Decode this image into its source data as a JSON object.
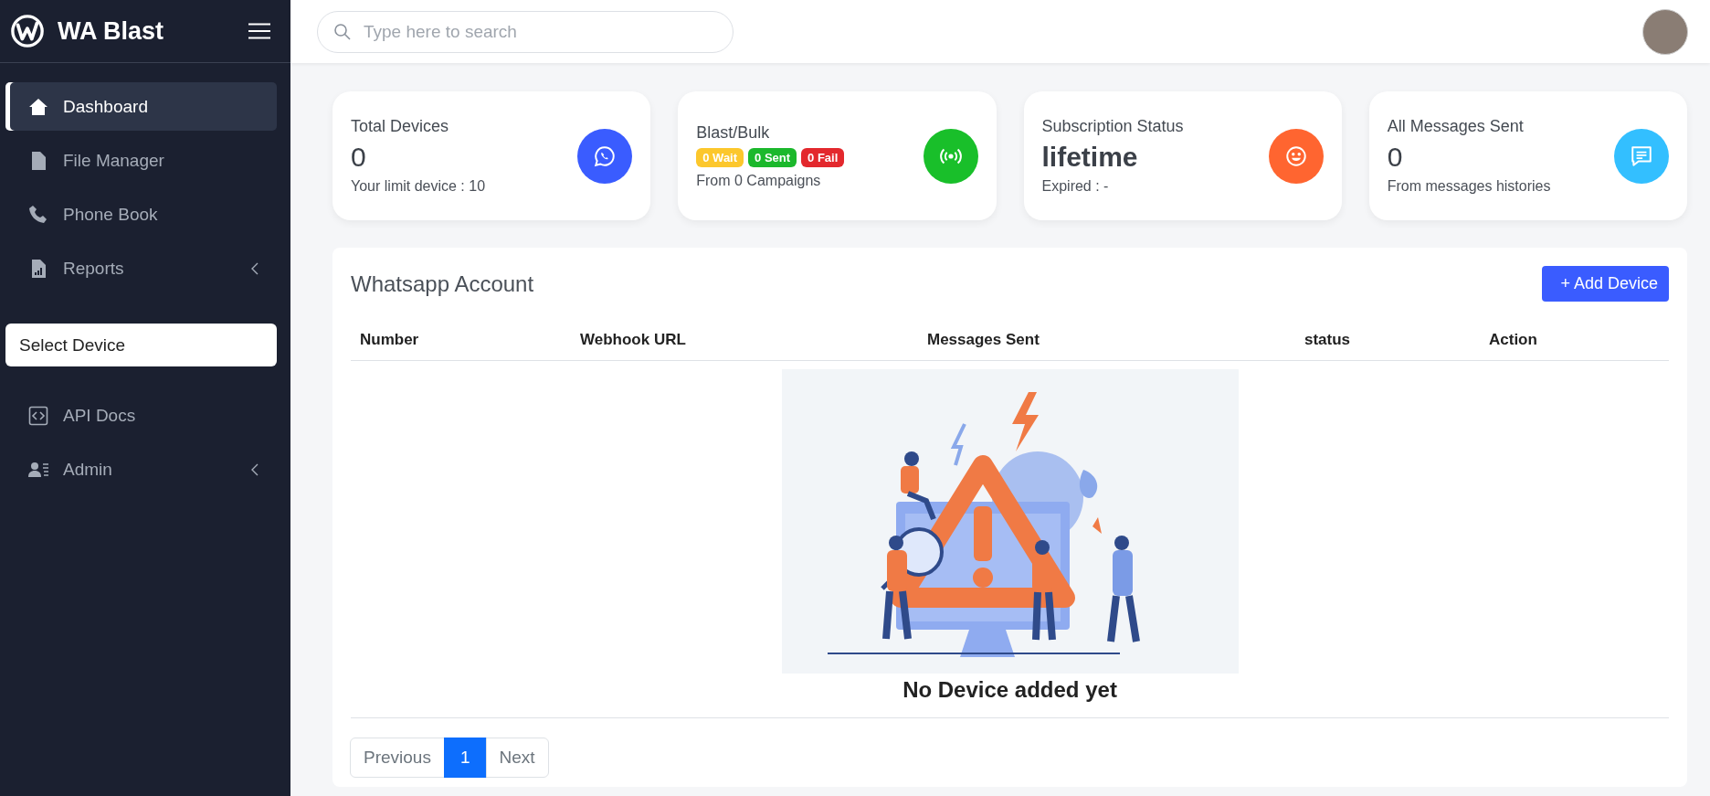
{
  "sidebar": {
    "brand": "WA Blast",
    "items": [
      {
        "label": "Dashboard",
        "selected": true,
        "submenu": false
      },
      {
        "label": "File Manager",
        "selected": false,
        "submenu": false
      },
      {
        "label": "Phone Book",
        "selected": false,
        "submenu": false
      },
      {
        "label": "Reports",
        "selected": false,
        "submenu": true
      }
    ],
    "device_select": {
      "value": "Select Device"
    },
    "items_after": [
      {
        "label": "API Docs",
        "selected": false,
        "submenu": false
      },
      {
        "label": "Admin",
        "selected": false,
        "submenu": true
      }
    ]
  },
  "topbar": {
    "search": {
      "placeholder": "Type here to search"
    }
  },
  "cards": [
    {
      "title": "Total Devices",
      "value": "0",
      "note": "Your limit device : 10",
      "color": "#3a5cff"
    },
    {
      "title": "Blast/Bulk",
      "badges": [
        {
          "label": "0 Wait",
          "color": "#fcc72c"
        },
        {
          "label": "0 Sent",
          "color": "#1bb82c"
        },
        {
          "label": "0 Fail",
          "color": "#e3282d"
        }
      ],
      "note": "From 0 Campaigns",
      "color": "#19bf2a"
    },
    {
      "title": "Subscription Status",
      "value": "lifetime",
      "note": "Expired : -",
      "color": "#ff6530"
    },
    {
      "title": "All Messages Sent",
      "value": "0",
      "note": "From messages histories",
      "color": "#33bfff"
    }
  ],
  "panel": {
    "title": "Whatsapp Account",
    "add_button": "+ Add Device",
    "table": {
      "columns": [
        "Number",
        "Webhook URL",
        "Messages Sent",
        "status",
        "Action"
      ],
      "empty_message": "No Device added yet"
    },
    "pagination": [
      {
        "label": "Previous",
        "selected": false
      },
      {
        "label": "1",
        "selected": true
      },
      {
        "label": "Next",
        "selected": false
      }
    ]
  }
}
